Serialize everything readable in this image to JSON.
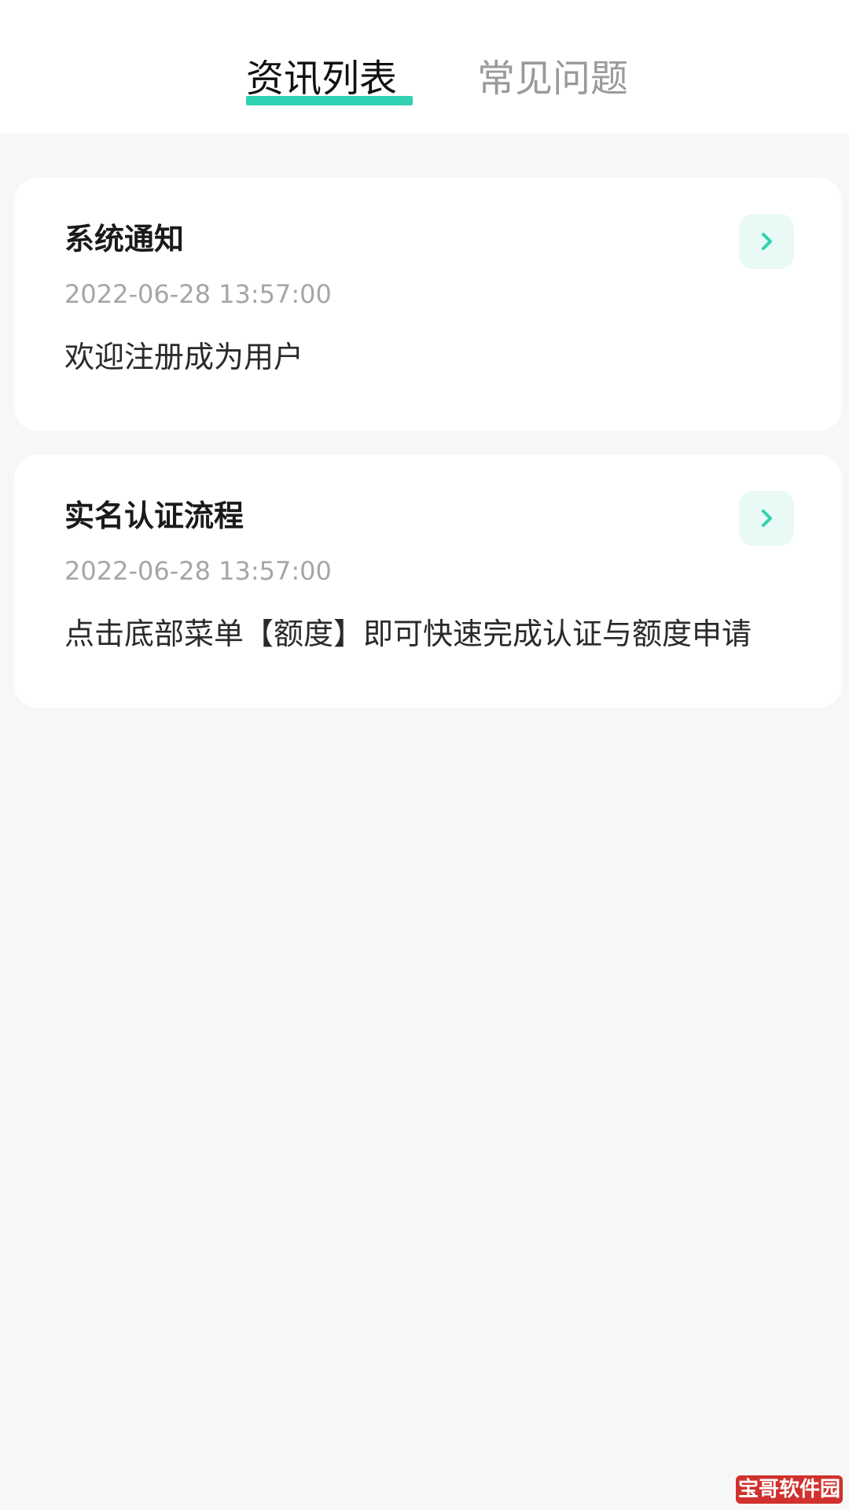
{
  "tabs": [
    {
      "label": "资讯列表",
      "active": true
    },
    {
      "label": "常见问题",
      "active": false
    }
  ],
  "accent_color": "#2fd2b2",
  "news": [
    {
      "title": "系统通知",
      "time": "2022-06-28 13:57:00",
      "body": "欢迎注册成为用户",
      "icon": "chevron-right-icon"
    },
    {
      "title": "实名认证流程",
      "time": "2022-06-28 13:57:00",
      "body": "点击底部菜单【额度】即可快速完成认证与额度申请",
      "icon": "chevron-right-icon"
    }
  ],
  "watermark": "宝哥软件园"
}
